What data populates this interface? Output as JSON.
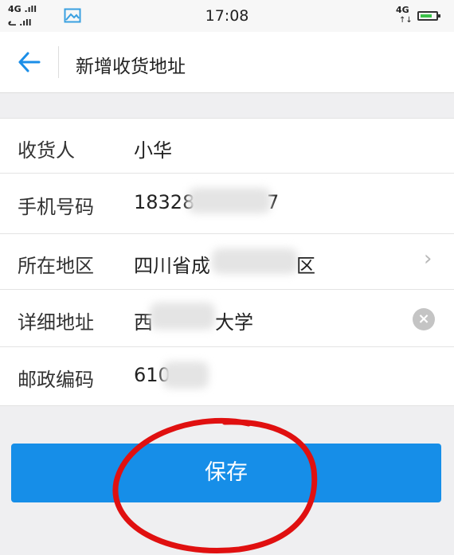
{
  "status_bar": {
    "left_signal_1": "4G .ıll",
    "left_signal_2": "ᓚ .ıll",
    "time": "17:08",
    "right_network": "4G",
    "right_arrows": "↑↓",
    "battery_color": "#3cc24a"
  },
  "nav": {
    "back_icon": "arrow-left-icon",
    "title": "新增收货地址"
  },
  "form": {
    "recipient": {
      "label": "收货人",
      "value": "小华"
    },
    "phone": {
      "label": "手机号码",
      "prefix": "18328",
      "suffix": "7"
    },
    "region": {
      "label": "所在地区",
      "prefix": "四川省成",
      "suffix": "区",
      "chevron": "›"
    },
    "address": {
      "label": "详细地址",
      "prefix": "西",
      "suffix": "大学",
      "clear_icon": "×"
    },
    "postal": {
      "label": "邮政编码",
      "prefix": "610"
    }
  },
  "save_button": {
    "label": "保存",
    "color": "#168ee8"
  },
  "annotation_color": "#e01010"
}
